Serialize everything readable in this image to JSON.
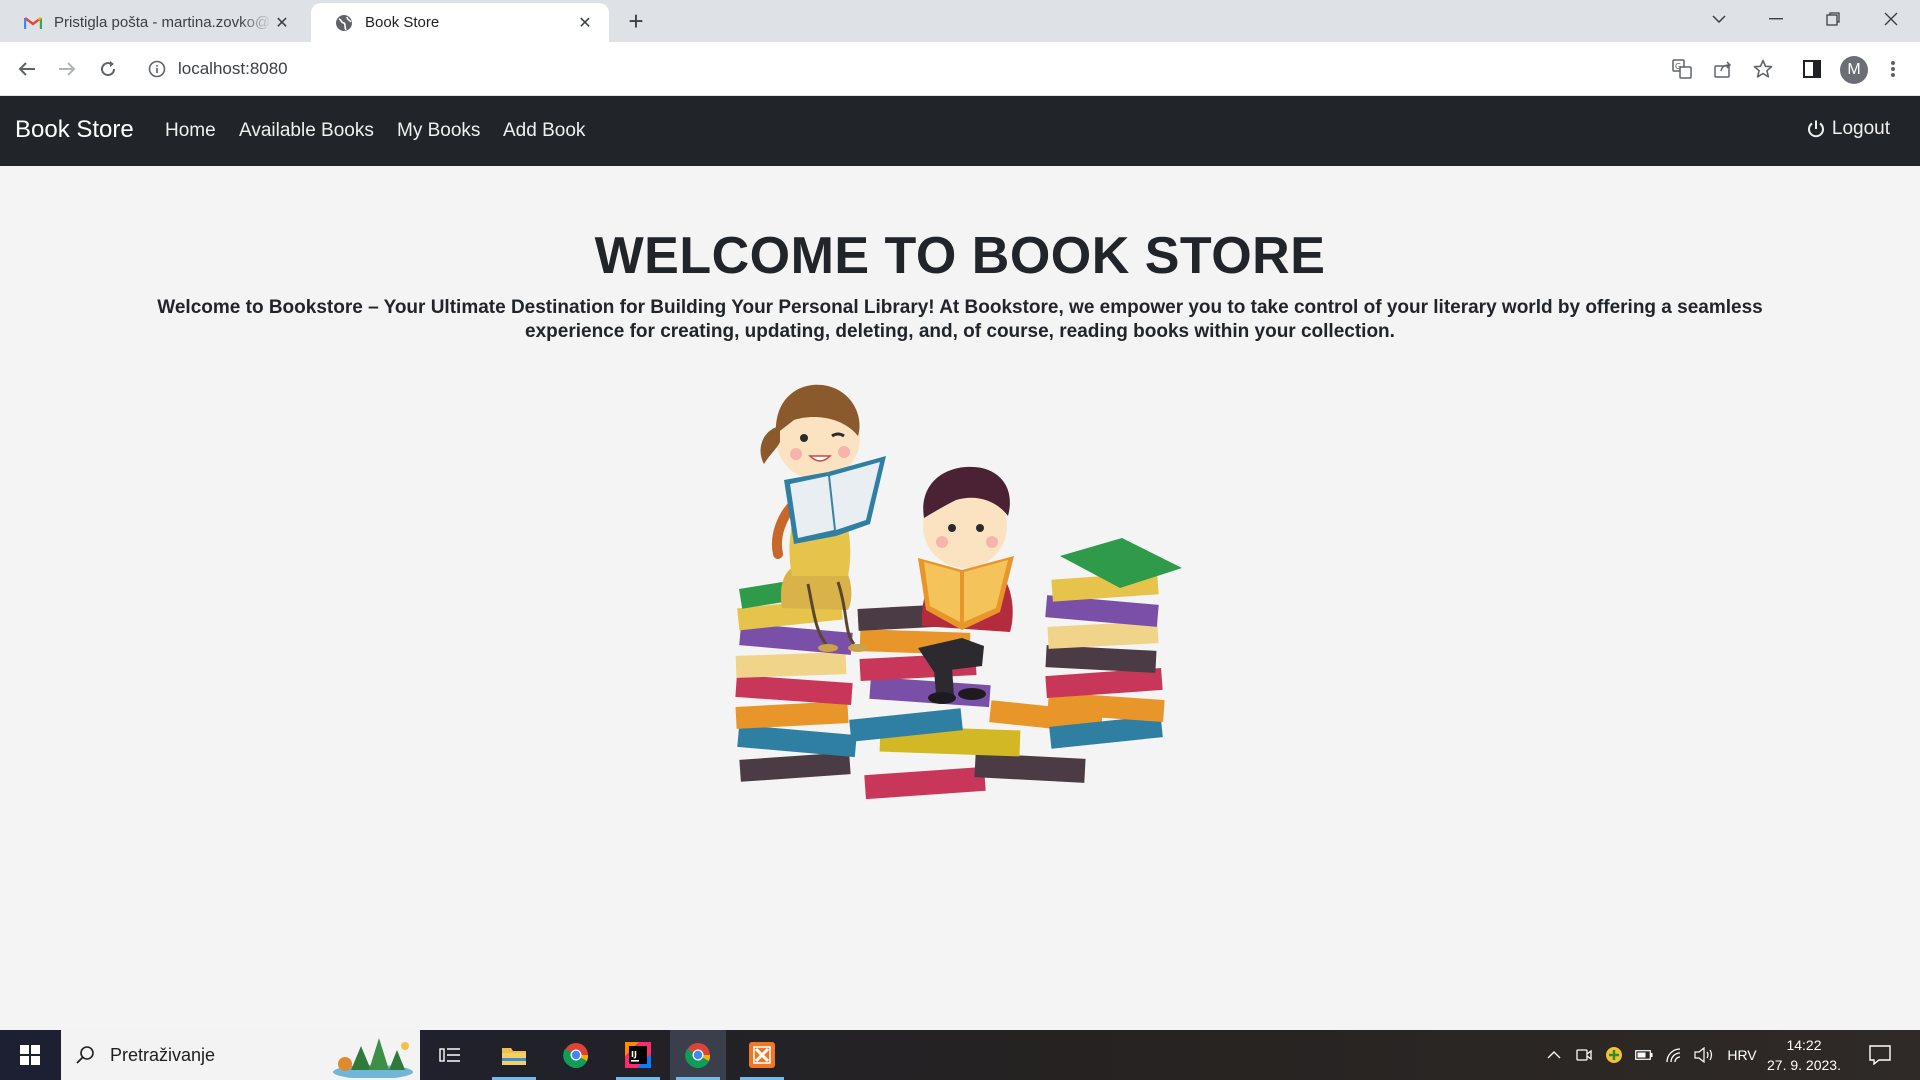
{
  "browser": {
    "tabs": [
      {
        "title": "Pristigla pošta - martina.zovko@",
        "icon": "gmail-icon"
      },
      {
        "title": "Book Store",
        "icon": "globe-icon"
      }
    ],
    "new_tab": "+",
    "address": "localhost:8080",
    "profile_initial": "M"
  },
  "app": {
    "brand": "Book Store",
    "nav": [
      {
        "label": "Home"
      },
      {
        "label": "Available Books"
      },
      {
        "label": "My Books"
      },
      {
        "label": "Add Book"
      }
    ],
    "logout_label": "Logout"
  },
  "main": {
    "title": "WELCOME TO BOOK STORE",
    "intro": "Welcome to Bookstore – Your Ultimate Destination for Building Your Personal Library! At Bookstore, we empower you to take control of your literary world by offering a seamless experience for creating, updating, deleting, and, of course, reading books within your collection."
  },
  "taskbar": {
    "search_placeholder": "Pretraživanje",
    "language": "HRV",
    "time": "14:22",
    "date": "27. 9. 2023."
  },
  "colors": {
    "navbar": "#212529",
    "page_bg": "#f4f4f4",
    "tabstrip": "#dee1e6"
  }
}
